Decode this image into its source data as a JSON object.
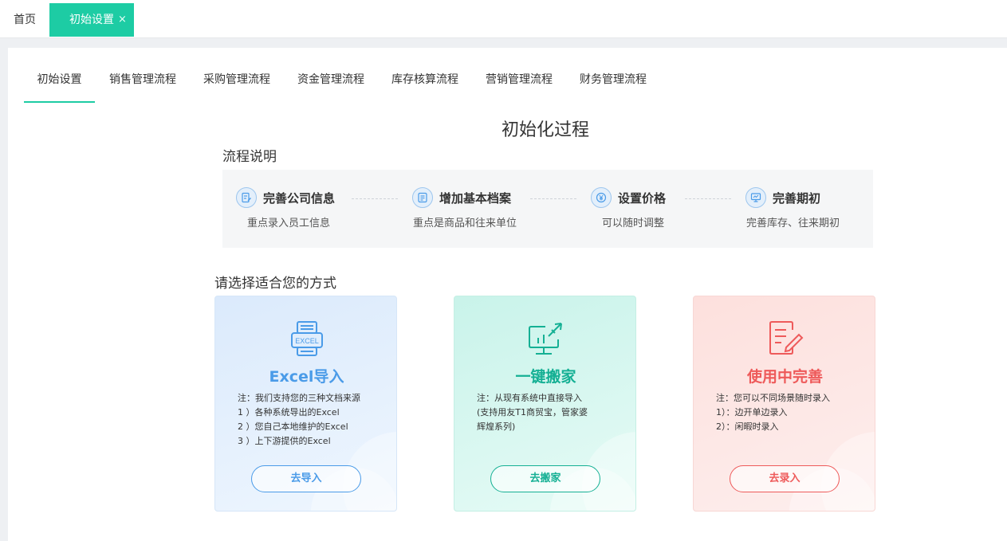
{
  "topbar": {
    "home_tab": "首页",
    "active_tab": "初始设置",
    "close_glyph": "×"
  },
  "subtabs": [
    {
      "label": "初始设置",
      "active": true
    },
    {
      "label": "销售管理流程",
      "active": false
    },
    {
      "label": "采购管理流程",
      "active": false
    },
    {
      "label": "资金管理流程",
      "active": false
    },
    {
      "label": "库存核算流程",
      "active": false
    },
    {
      "label": "营销管理流程",
      "active": false
    },
    {
      "label": "财务管理流程",
      "active": false
    }
  ],
  "page_title": "初始化过程",
  "flow": {
    "title": "流程说明",
    "steps": [
      {
        "title": "完善公司信息",
        "desc": "重点录入员工信息",
        "icon": "edit-doc-icon"
      },
      {
        "title": "增加基本档案",
        "desc": "重点是商品和往来单位",
        "icon": "file-list-icon"
      },
      {
        "title": "设置价格",
        "desc": "可以随时调整",
        "icon": "yen-coin-icon"
      },
      {
        "title": "完善期初",
        "desc": "完善库存、往来期初",
        "icon": "monitor-icon"
      }
    ]
  },
  "choose": {
    "title": "请选择适合您的方式",
    "cards": [
      {
        "title": "Excel导入",
        "notes": [
          "注：我们支持您的三种文档来源",
          "1 ）各种系统导出的Excel",
          "2 ）您自己本地维护的Excel",
          "3 ）上下游提供的Excel"
        ],
        "button": "去导入",
        "icon": "excel-icon",
        "color": "#4a9be8"
      },
      {
        "title": "一键搬家",
        "notes": [
          "注：从现有系统中直接导入",
          "(支持用友T1商贸宝，管家婆",
          "辉煌系列)"
        ],
        "button": "去搬家",
        "icon": "rocket-monitor-icon",
        "color": "#15b094"
      },
      {
        "title": "使用中完善",
        "notes": [
          "注：您可以不同场景随时录入",
          "1）：边开单边录入",
          "2）：闲暇时录入"
        ],
        "button": "去录入",
        "icon": "edit-pen-icon",
        "color": "#ee5a5a"
      }
    ]
  },
  "colors": {
    "accent": "#1dcca4",
    "excel": "#4a9be8",
    "move": "#15b094",
    "use": "#ee5a5a"
  }
}
